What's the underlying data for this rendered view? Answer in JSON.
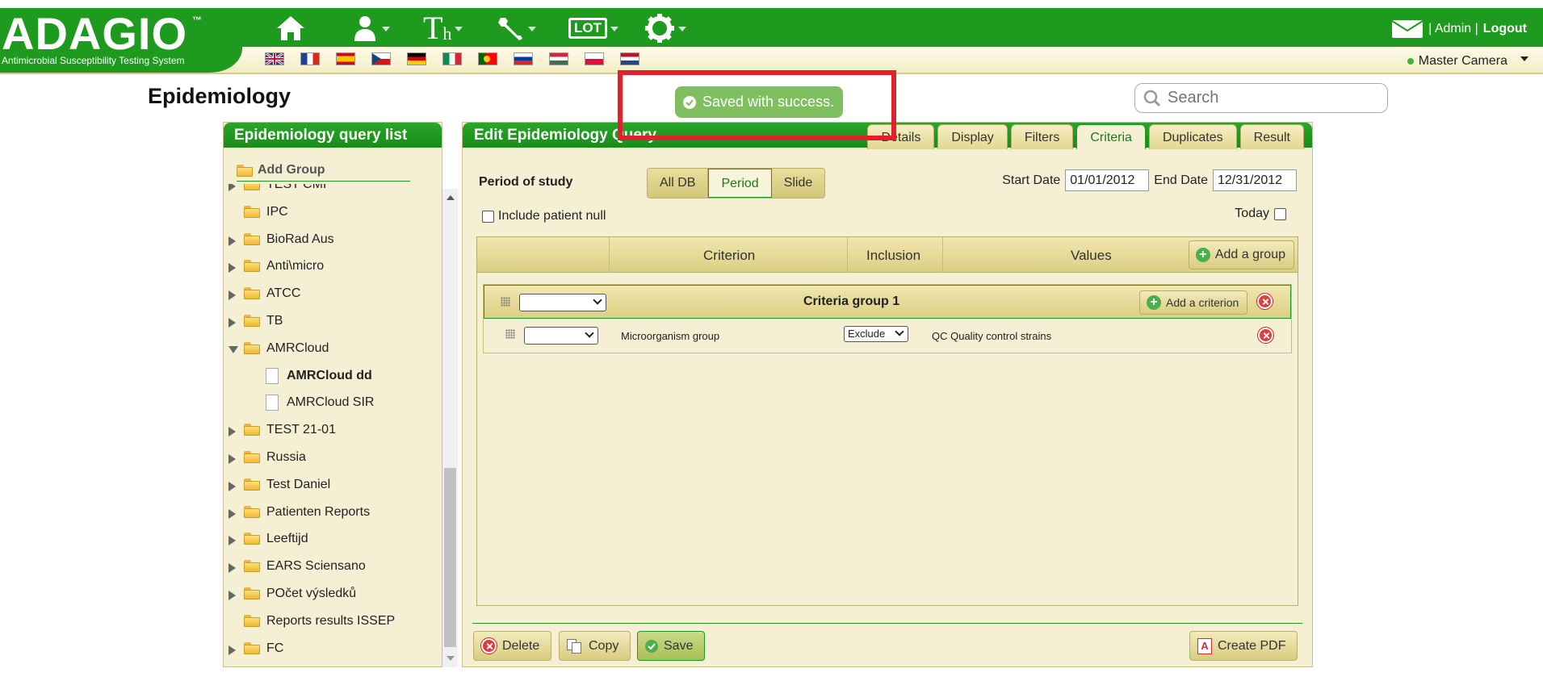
{
  "app": {
    "logo": "ADAGIO",
    "logo_tm": "™",
    "tagline": "Antimicrobial Susceptibility Testing System"
  },
  "nav": {
    "icons": [
      "home-icon",
      "user-icon",
      "th-icon",
      "wrench-icon",
      "lot-icon",
      "settings-icon"
    ],
    "th_label": "T",
    "th_sub": "h",
    "lot_label": "LOT"
  },
  "flags": [
    "UK",
    "FR",
    "ES",
    "CZ",
    "DE",
    "IT",
    "PT",
    "RU",
    "HU",
    "PL",
    "NL"
  ],
  "top_right": {
    "admin": "| Admin |",
    "logout": "Logout",
    "camera": "Master Camera"
  },
  "page": {
    "title": "Epidemiology"
  },
  "search": {
    "placeholder": "Search"
  },
  "toast": {
    "message": "Saved with success."
  },
  "left_panel": {
    "title": "Epidemiology query list",
    "add_group": "Add Group",
    "items": [
      {
        "label": "TEST CMI",
        "type": "folder",
        "expand": "right"
      },
      {
        "label": "IPC",
        "type": "folder",
        "expand": "none"
      },
      {
        "label": "BioRad Aus",
        "type": "folder",
        "expand": "right"
      },
      {
        "label": "Anti\\micro",
        "type": "folder",
        "expand": "right"
      },
      {
        "label": "ATCC",
        "type": "folder",
        "expand": "right"
      },
      {
        "label": "TB",
        "type": "folder",
        "expand": "right"
      },
      {
        "label": "AMRCloud",
        "type": "folder",
        "expand": "down"
      },
      {
        "label": "AMRCloud dd",
        "type": "doc",
        "bold": true
      },
      {
        "label": "AMRCloud SIR",
        "type": "doc"
      },
      {
        "label": "TEST 21-01",
        "type": "folder",
        "expand": "right"
      },
      {
        "label": "Russia",
        "type": "folder",
        "expand": "right"
      },
      {
        "label": "Test Daniel",
        "type": "folder",
        "expand": "right"
      },
      {
        "label": "Patienten Reports",
        "type": "folder",
        "expand": "right"
      },
      {
        "label": "Leeftijd",
        "type": "folder",
        "expand": "right"
      },
      {
        "label": "EARS Sciensano",
        "type": "folder",
        "expand": "right"
      },
      {
        "label": "POčet výsledků",
        "type": "folder",
        "expand": "right"
      },
      {
        "label": "Reports results ISSEP",
        "type": "folder",
        "expand": "none"
      },
      {
        "label": "FC",
        "type": "folder",
        "expand": "right"
      }
    ]
  },
  "right_panel": {
    "title": "Edit Epidemiology Query",
    "tabs": [
      {
        "label": "Details",
        "active": false
      },
      {
        "label": "Display",
        "active": false
      },
      {
        "label": "Filters",
        "active": false
      },
      {
        "label": "Criteria",
        "active": true
      },
      {
        "label": "Duplicates",
        "active": false
      },
      {
        "label": "Result",
        "active": false
      }
    ],
    "period_label": "Period of study",
    "period_options": [
      {
        "label": "All DB",
        "active": false
      },
      {
        "label": "Period",
        "active": true
      },
      {
        "label": "Slide",
        "active": false
      }
    ],
    "start_date_label": "Start Date",
    "start_date": "01/01/2012",
    "end_date_label": "End Date",
    "end_date": "12/31/2012",
    "include_null_label": "Include patient null",
    "today_label": "Today"
  },
  "criteria": {
    "columns": [
      "Criterion",
      "Inclusion",
      "Values"
    ],
    "add_group_label": "Add a group",
    "group": {
      "title": "Criteria group 1",
      "add_criterion_label": "Add a criterion",
      "row": {
        "criterion": "Microorganism group",
        "inclusion": "Exclude",
        "values": "QC Quality control strains"
      }
    }
  },
  "actions": {
    "delete": "Delete",
    "copy": "Copy",
    "save": "Save",
    "create_pdf": "Create PDF"
  },
  "colors": {
    "brand_green": "#1e9a1e",
    "panel_bg": "#f5efd3",
    "toast_green": "#7fbf5f",
    "highlight_red": "#e0202a"
  }
}
